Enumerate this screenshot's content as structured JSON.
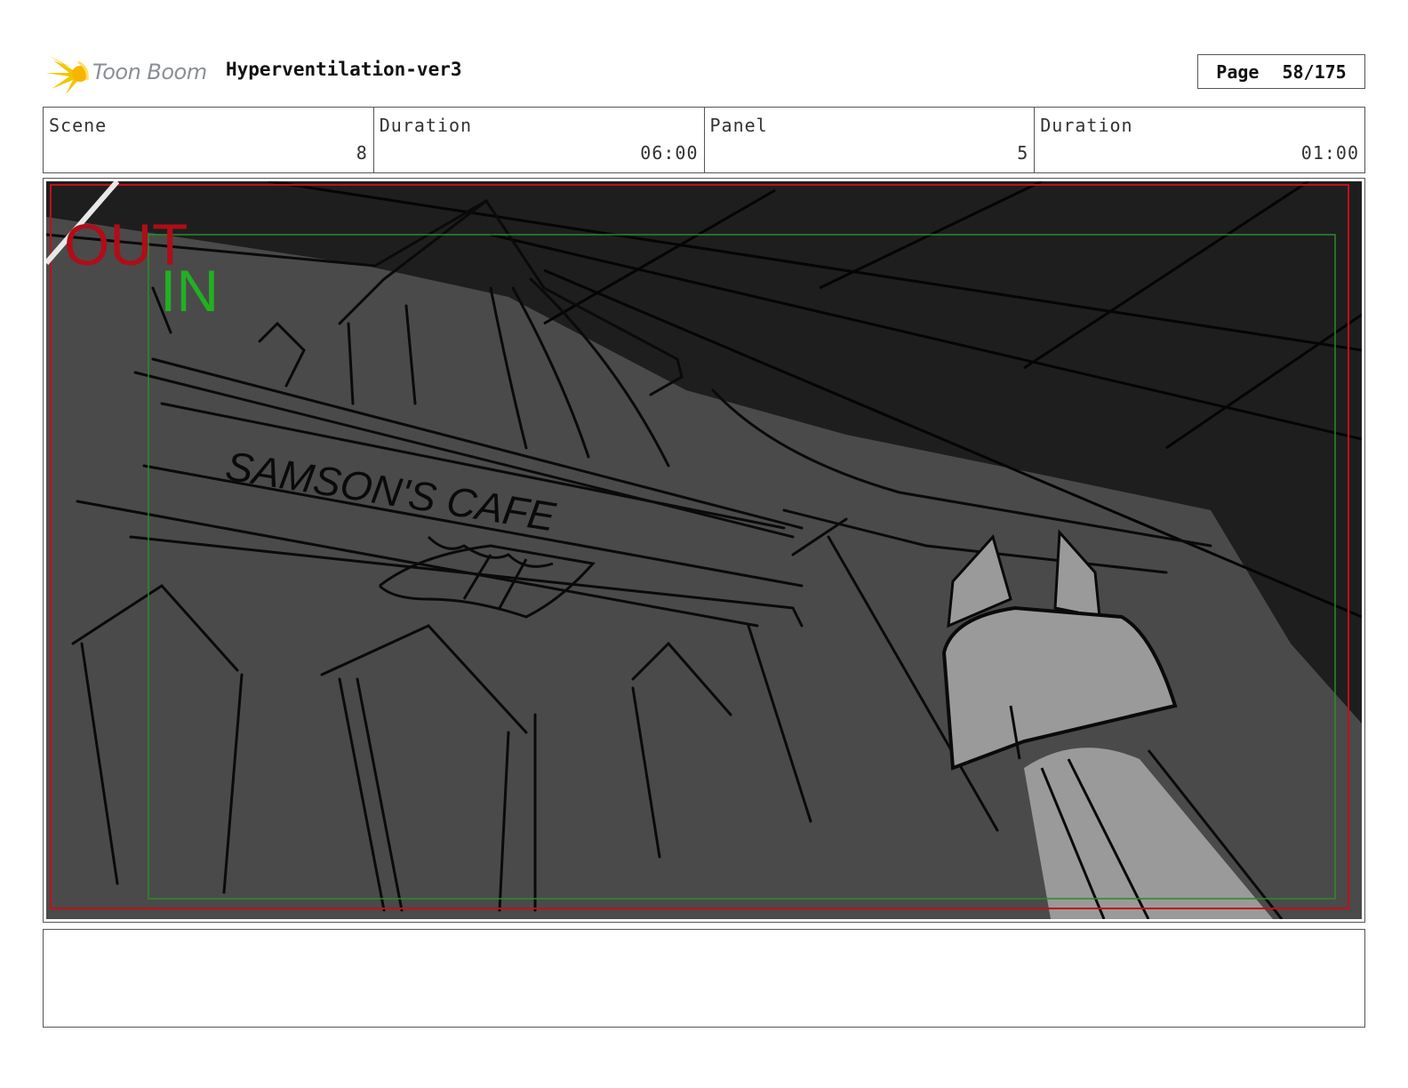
{
  "header": {
    "logo_text": "Toon Boom",
    "project_title": "Hyperventilation-ver3",
    "page_label": "Page",
    "page_value": "58/175"
  },
  "info": {
    "scene_label": "Scene",
    "scene_value": "8",
    "scene_duration_label": "Duration",
    "scene_duration_value": "06:00",
    "panel_label": "Panel",
    "panel_value": "5",
    "panel_duration_label": "Duration",
    "panel_duration_value": "01:00"
  },
  "panel": {
    "out_label": "OUT",
    "in_label": "IN",
    "sign_text": "SAMSON'S CAFE",
    "colors": {
      "background": "#4a4a4a",
      "ceiling": "#1e1e1e",
      "character": "#9a9a9a",
      "out_frame": "#c0101a",
      "in_frame": "#2a8a2a",
      "in_text": "#22b022"
    }
  },
  "notes": {
    "text": ""
  }
}
